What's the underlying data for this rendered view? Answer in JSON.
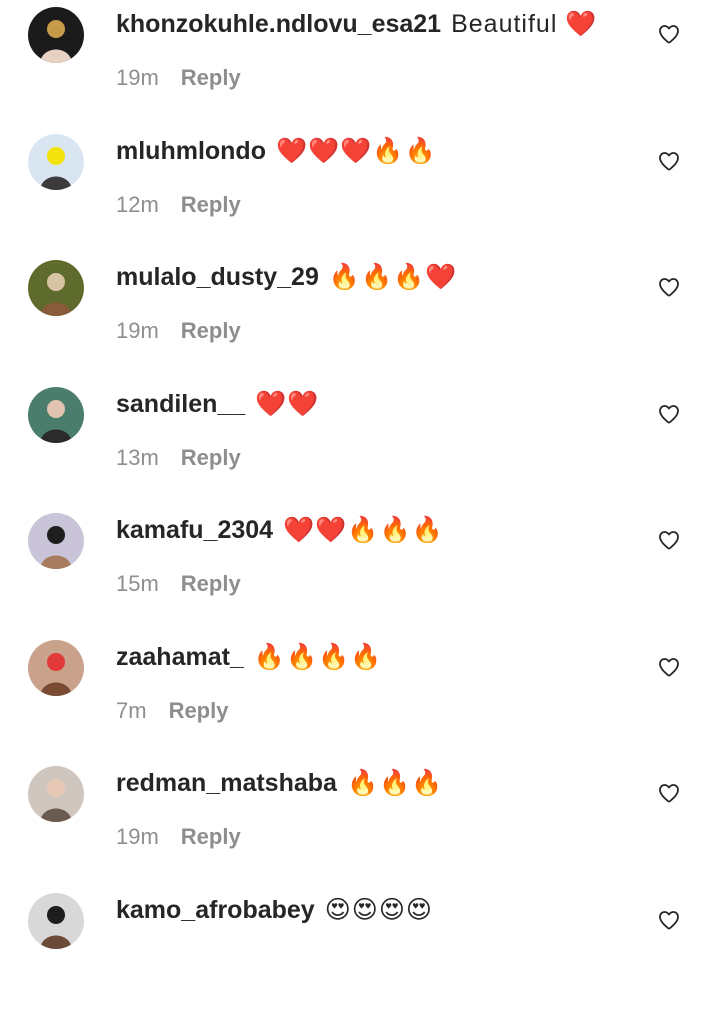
{
  "comments": [
    {
      "username": "khonzokuhle.ndlovu_esa21",
      "text": "Beautiful ❤️",
      "time": "19m",
      "reply_label": "Reply",
      "avatar_colors": [
        "#1b1b1b",
        "#c79a4a",
        "#e8d1c2"
      ]
    },
    {
      "username": "mluhmlondo",
      "text": "❤️❤️❤️🔥🔥",
      "time": "12m",
      "reply_label": "Reply",
      "avatar_colors": [
        "#d9e6f2",
        "#f2e20c",
        "#3b3b3b"
      ]
    },
    {
      "username": "mulalo_dusty_29",
      "text": "🔥🔥🔥❤️",
      "time": "19m",
      "reply_label": "Reply",
      "avatar_colors": [
        "#5f6b2c",
        "#d8c3a5",
        "#8a5b3a"
      ]
    },
    {
      "username": "sandilen__",
      "text": "❤️❤️",
      "time": "13m",
      "reply_label": "Reply",
      "avatar_colors": [
        "#4a7d6b",
        "#e0c3b0",
        "#2b2b2b"
      ]
    },
    {
      "username": "kamafu_2304",
      "text": "❤️❤️🔥🔥🔥",
      "time": "15m",
      "reply_label": "Reply",
      "avatar_colors": [
        "#c9c4d8",
        "#1e1e1e",
        "#a87a5e"
      ]
    },
    {
      "username": "zaahamat_",
      "text": "🔥🔥🔥🔥",
      "time": "7m",
      "reply_label": "Reply",
      "avatar_colors": [
        "#c8a28a",
        "#e23a3a",
        "#7a4a32"
      ]
    },
    {
      "username": "redman_matshaba",
      "text": "🔥🔥🔥",
      "time": "19m",
      "reply_label": "Reply",
      "avatar_colors": [
        "#cfc6c0",
        "#e6c7b6",
        "#6b5a50"
      ]
    },
    {
      "username": "kamo_afrobabey",
      "text": "😍😍😍😍",
      "time": "",
      "reply_label": "",
      "avatar_colors": [
        "#d8d8d8",
        "#1d1d1d",
        "#6b4a3a"
      ]
    }
  ],
  "icons": {
    "like": "heart-outline-icon"
  },
  "colors": {
    "text_primary": "#262626",
    "text_secondary": "#8e8e8e",
    "background": "#ffffff"
  }
}
